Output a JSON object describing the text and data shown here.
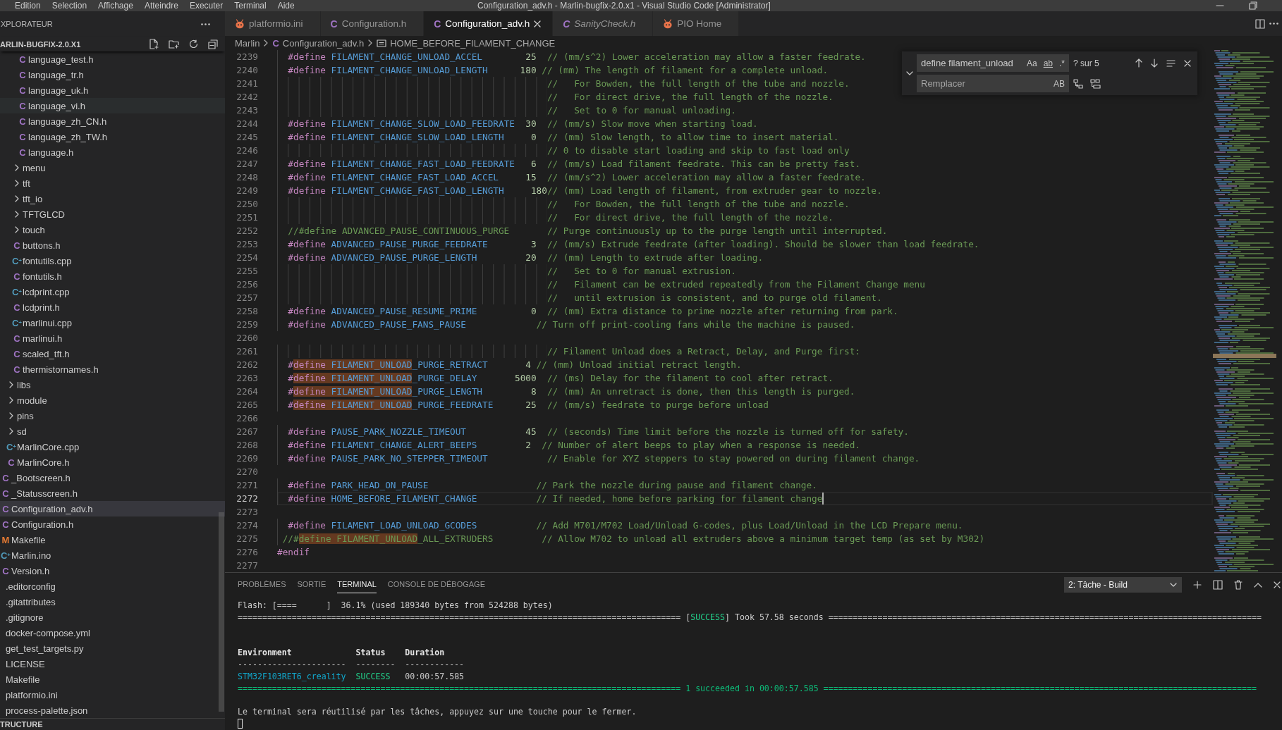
{
  "title_bar": {
    "menu": [
      "Edition",
      "Selection",
      "Affichage",
      "Atteindre",
      "Executer",
      "Terminal",
      "Aide"
    ],
    "title": "Configuration_adv.h - Marlin-bugfix-2.0.x1 - Visual Studio Code [Administrator]"
  },
  "sidebar": {
    "title": "XPLORATEUR",
    "project": "ARLIN-BUGFIX-2.0.X1",
    "tree": [
      {
        "children": [
          {
            "children": [
              {
                "children": [
                  {
                    "children": [
                      {
                        "label": "language_test.h",
                        "kind": "c",
                        "glyph": "C",
                        "selected": false,
                        "hovered": false
                      },
                      {
                        "label": "language_tr.h",
                        "kind": "c",
                        "glyph": "C",
                        "selected": false,
                        "hovered": false
                      },
                      {
                        "label": "language_uk.h",
                        "kind": "c",
                        "glyph": "C",
                        "selected": false,
                        "hovered": false
                      },
                      {
                        "label": "language_vi.h",
                        "kind": "c",
                        "glyph": "C",
                        "selected": false,
                        "hovered": true
                      },
                      {
                        "label": "language_zh_CN.h",
                        "kind": "c",
                        "glyph": "C",
                        "selected": false,
                        "hovered": false
                      },
                      {
                        "label": "language_zh_TW.h",
                        "kind": "c",
                        "glyph": "C",
                        "selected": false,
                        "hovered": false
                      },
                      {
                        "label": "language.h",
                        "kind": "c",
                        "glyph": "C",
                        "selected": false,
                        "hovered": false
                      }
                    ]
                  },
                  {
                    "label": "menu",
                    "kind": "folder",
                    "expanded": false,
                    "selected": false,
                    "hovered": false
                  },
                  {
                    "label": "tft",
                    "kind": "folder",
                    "expanded": false,
                    "selected": false,
                    "hovered": false
                  },
                  {
                    "label": "tft_io",
                    "kind": "folder",
                    "expanded": false,
                    "selected": false,
                    "hovered": false
                  },
                  {
                    "label": "TFTGLCD",
                    "kind": "folder",
                    "expanded": false,
                    "selected": false,
                    "hovered": false
                  },
                  {
                    "label": "touch",
                    "kind": "folder",
                    "expanded": false,
                    "selected": false,
                    "hovered": false
                  },
                  {
                    "label": "buttons.h",
                    "kind": "c",
                    "glyph": "C",
                    "selected": false,
                    "hovered": false
                  },
                  {
                    "label": "fontutils.cpp",
                    "kind": "cpp",
                    "glyph": "C$^{+}$",
                    "selected": false,
                    "hovered": false
                  },
                  {
                    "label": "fontutils.h",
                    "kind": "c",
                    "glyph": "C",
                    "selected": false,
                    "hovered": false
                  },
                  {
                    "label": "lcdprint.cpp",
                    "kind": "cpp",
                    "glyph": "C$^{+}$",
                    "selected": false,
                    "hovered": false
                  },
                  {
                    "label": "lcdprint.h",
                    "kind": "c",
                    "glyph": "C",
                    "selected": false,
                    "hovered": false
                  },
                  {
                    "label": "marlinui.cpp",
                    "kind": "cpp",
                    "glyph": "C$^{+}$",
                    "selected": false,
                    "hovered": false
                  },
                  {
                    "label": "marlinui.h",
                    "kind": "c",
                    "glyph": "C",
                    "selected": false,
                    "hovered": false
                  },
                  {
                    "label": "scaled_tft.h",
                    "kind": "c",
                    "glyph": "C",
                    "selected": false,
                    "hovered": false
                  },
                  {
                    "label": "thermistornames.h",
                    "kind": "c",
                    "glyph": "C",
                    "selected": false,
                    "hovered": false
                  }
                ]
              },
              {
                "label": "libs",
                "kind": "folder",
                "expanded": false,
                "selected": false,
                "hovered": false
              },
              {
                "label": "module",
                "kind": "folder",
                "expanded": false,
                "selected": false,
                "hovered": false
              },
              {
                "label": "pins",
                "kind": "folder",
                "expanded": false,
                "selected": false,
                "hovered": false
              },
              {
                "label": "sd",
                "kind": "folder",
                "expanded": false,
                "selected": false,
                "hovered": false
              },
              {
                "label": "MarlinCore.cpp",
                "kind": "cpp",
                "glyph": "C$^{+}$",
                "selected": false,
                "hovered": false
              },
              {
                "label": "MarlinCore.h",
                "kind": "c",
                "glyph": "C",
                "selected": false,
                "hovered": false
              }
            ]
          },
          {
            "label": "_Bootscreen.h",
            "kind": "c",
            "glyph": "C",
            "selected": false,
            "hovered": false
          },
          {
            "label": "_Statusscreen.h",
            "kind": "c",
            "glyph": "C",
            "selected": false,
            "hovered": false
          },
          {
            "label": "Configuration_adv.h",
            "kind": "c",
            "glyph": "C",
            "selected": true,
            "hovered": false
          },
          {
            "label": "Configuration.h",
            "kind": "c",
            "glyph": "C",
            "selected": false,
            "hovered": false
          },
          {
            "label": "Makefile",
            "kind": "make",
            "glyph": "M",
            "selected": false,
            "hovered": false
          },
          {
            "label": "Marlin.ino",
            "kind": "cpp",
            "glyph": "C$^{+}$",
            "selected": false,
            "hovered": false
          },
          {
            "label": "Version.h",
            "kind": "c",
            "glyph": "C",
            "selected": false,
            "hovered": false
          }
        ]
      },
      {
        "label": ".editorconfig",
        "selected": false,
        "hovered": false
      },
      {
        "label": ".gitattributes",
        "selected": false,
        "hovered": false
      },
      {
        "label": ".gitignore",
        "selected": false,
        "hovered": false
      },
      {
        "label": "docker-compose.yml",
        "selected": false,
        "hovered": false
      },
      {
        "label": "get_test_targets.py",
        "selected": false,
        "hovered": false
      },
      {
        "label": "LICENSE",
        "selected": false,
        "hovered": false
      },
      {
        "label": "Makefile",
        "selected": false,
        "hovered": false
      },
      {
        "label": "platformio.ini",
        "selected": false,
        "hovered": false
      },
      {
        "label": "process-palette.json",
        "selected": false,
        "hovered": false
      }
    ],
    "outline": "TRUCTURE"
  },
  "editor": {
    "tabs": [
      {
        "label": "platformio.ini",
        "kind": "pio",
        "selected": false,
        "preview": false
      },
      {
        "label": "Configuration.h",
        "kind": "c",
        "glyph": "C",
        "selected": false,
        "preview": false
      },
      {
        "label": "Configuration_adv.h",
        "kind": "c",
        "glyph": "C",
        "selected": true,
        "preview": false
      },
      {
        "label": "SanityCheck.h",
        "kind": "c",
        "glyph": "C",
        "selected": false,
        "preview": true
      },
      {
        "label": "PIO Home",
        "kind": "pio",
        "selected": false,
        "preview": false
      }
    ],
    "breadcrumbs": [
      {
        "kind": "folder",
        "label": "Marlin"
      },
      {
        "kind": "c",
        "glyph": "C",
        "label": "Configuration_adv.h"
      },
      {
        "kind": "symbol",
        "label": "HOME_BEFORE_FILAMENT_CHANGE"
      }
    ],
    "lines": [
      {
        "number": "2239",
        "current": false,
        "tokens": [
          {
            "kind": "directive",
            "text": "  #define",
            "match": false
          },
          {
            "kind": "macro",
            "text": " FILAMENT_CHANGE_UNLOAD_ACCEL",
            "match": false
          },
          {
            "kind": "number",
            "text": "        25",
            "match": false
          },
          {
            "kind": "comment",
            "text": "  // (mm/s^2) Lower acceleration may allow a faster feedrate.",
            "match": false
          }
        ]
      },
      {
        "number": "2240",
        "current": false,
        "tokens": [
          {
            "kind": "directive",
            "text": "  #define",
            "match": false
          },
          {
            "kind": "macro",
            "text": " FILAMENT_CHANGE_UNLOAD_LENGTH",
            "match": false
          },
          {
            "kind": "number",
            "text": "      180",
            "match": false
          },
          {
            "kind": "comment",
            "text": " // (mm) The length of filament for a complete unload.",
            "match": false
          }
        ]
      },
      {
        "number": "2241",
        "current": false,
        "tokens": [
          {
            "kind": "comment",
            "text": "                                                  //   For Bowden, the full length of the tube and nozzle.",
            "match": false
          }
        ]
      },
      {
        "number": "2242",
        "current": false,
        "tokens": [
          {
            "kind": "comment",
            "text": "                                                  //   For direct drive, the full length of the nozzle.",
            "match": false
          }
        ]
      },
      {
        "number": "2243",
        "current": false,
        "tokens": [
          {
            "kind": "comment",
            "text": "                                                  //   Set to 0 for manual unloading.",
            "match": false
          }
        ]
      },
      {
        "number": "2244",
        "current": false,
        "tokens": [
          {
            "kind": "directive",
            "text": "  #define",
            "match": false
          },
          {
            "kind": "macro",
            "text": " FILAMENT_CHANGE_SLOW_LOAD_FEEDRATE",
            "match": false
          },
          {
            "kind": "number",
            "text": "  30",
            "match": false
          },
          {
            "kind": "comment",
            "text": "  // (mm/s) Slow move when starting load.",
            "match": false
          }
        ]
      },
      {
        "number": "2245",
        "current": false,
        "tokens": [
          {
            "kind": "directive",
            "text": "  #define",
            "match": false
          },
          {
            "kind": "macro",
            "text": " FILAMENT_CHANGE_SLOW_LOAD_LENGTH",
            "match": false
          },
          {
            "kind": "number",
            "text": "     0",
            "match": false
          },
          {
            "kind": "comment",
            "text": "  // (mm) Slow length, to allow time to insert material.",
            "match": false
          }
        ]
      },
      {
        "number": "2246",
        "current": false,
        "tokens": [
          {
            "kind": "comment",
            "text": "                                                  // 0 to disable start loading and skip to fast load only",
            "match": false
          }
        ]
      },
      {
        "number": "2247",
        "current": false,
        "tokens": [
          {
            "kind": "directive",
            "text": "  #define",
            "match": false
          },
          {
            "kind": "macro",
            "text": " FILAMENT_CHANGE_FAST_LOAD_FEEDRATE",
            "match": false
          },
          {
            "kind": "number",
            "text": "   6",
            "match": false
          },
          {
            "kind": "comment",
            "text": "  // (mm/s) Load filament feedrate. This can be pretty fast.",
            "match": false
          }
        ]
      },
      {
        "number": "2248",
        "current": false,
        "tokens": [
          {
            "kind": "directive",
            "text": "  #define",
            "match": false
          },
          {
            "kind": "macro",
            "text": " FILAMENT_CHANGE_FAST_LOAD_ACCEL",
            "match": false
          },
          {
            "kind": "number",
            "text": "     15",
            "match": false
          },
          {
            "kind": "comment",
            "text": "  // (mm/s^2) Lower acceleration may allow a faster feedrate.",
            "match": false
          }
        ]
      },
      {
        "number": "2249",
        "current": false,
        "tokens": [
          {
            "kind": "directive",
            "text": "  #define",
            "match": false
          },
          {
            "kind": "macro",
            "text": " FILAMENT_CHANGE_FAST_LOAD_LENGTH",
            "match": false
          },
          {
            "kind": "number",
            "text": "     180",
            "match": false
          },
          {
            "kind": "comment",
            "text": "// (mm) Load length of filament, from extruder gear to nozzle.",
            "match": false
          }
        ]
      },
      {
        "number": "2250",
        "current": false,
        "tokens": [
          {
            "kind": "comment",
            "text": "                                                  //   For Bowden, the full length of the tube and nozzle.",
            "match": false
          }
        ]
      },
      {
        "number": "2251",
        "current": false,
        "tokens": [
          {
            "kind": "comment",
            "text": "                                                  //   For direct drive, the full length of the nozzle.",
            "match": false
          }
        ]
      },
      {
        "number": "2252",
        "current": false,
        "tokens": [
          {
            "kind": "comment",
            "text": "  //#define ADVANCED_PAUSE_CONTINUOUS_PURGE       // Purge continuously up to the purge length until interrupted.",
            "match": false
          }
        ]
      },
      {
        "number": "2253",
        "current": false,
        "tokens": [
          {
            "kind": "directive",
            "text": "  #define",
            "match": false
          },
          {
            "kind": "macro",
            "text": " ADVANCED_PAUSE_PURGE_FEEDRATE",
            "match": false
          },
          {
            "kind": "number",
            "text": "        3",
            "match": false
          },
          {
            "kind": "comment",
            "text": "  // (mm/s) Extrude feedrate (after loading). Should be slower than load feedrate.",
            "match": false
          }
        ]
      },
      {
        "number": "2254",
        "current": false,
        "tokens": [
          {
            "kind": "directive",
            "text": "  #define",
            "match": false
          },
          {
            "kind": "macro",
            "text": " ADVANCED_PAUSE_PURGE_LENGTH",
            "match": false
          },
          {
            "kind": "number",
            "text": "         20",
            "match": false
          },
          {
            "kind": "comment",
            "text": "  // (mm) Length to extrude after loading.",
            "match": false
          }
        ]
      },
      {
        "number": "2255",
        "current": false,
        "tokens": [
          {
            "kind": "comment",
            "text": "                                                  //   Set to 0 for manual extrusion.",
            "match": false
          }
        ]
      },
      {
        "number": "2256",
        "current": false,
        "tokens": [
          {
            "kind": "comment",
            "text": "                                                  //   Filament can be extruded repeatedly from the Filament Change menu",
            "match": false
          }
        ]
      },
      {
        "number": "2257",
        "current": false,
        "tokens": [
          {
            "kind": "comment",
            "text": "                                                  //   until extrusion is consistent, and to purge old filament.",
            "match": false
          }
        ]
      },
      {
        "number": "2258",
        "current": false,
        "tokens": [
          {
            "kind": "directive",
            "text": "  #define",
            "match": false
          },
          {
            "kind": "macro",
            "text": " ADVANCED_PAUSE_RESUME_PRIME",
            "match": false
          },
          {
            "kind": "number",
            "text": "          0",
            "match": false
          },
          {
            "kind": "comment",
            "text": "  // (mm) Extra distance to prime nozzle after returning from park.",
            "match": false
          }
        ]
      },
      {
        "number": "2259",
        "current": false,
        "tokens": [
          {
            "kind": "directive",
            "text": "  #define",
            "match": false
          },
          {
            "kind": "macro",
            "text": " ADVANCED_PAUSE_FANS_PAUSE",
            "match": false
          },
          {
            "kind": "comment",
            "text": "             // Turn off print-cooling fans while the machine is paused.",
            "match": false
          }
        ]
      },
      {
        "number": "2260",
        "current": false
      },
      {
        "number": "2261",
        "current": false,
        "tokens": [
          {
            "kind": "comment",
            "text": "                                                  // Filament Unload does a Retract, Delay, and Purge first:",
            "match": false
          }
        ]
      },
      {
        "number": "2262",
        "current": false,
        "tokens": [
          {
            "kind": "directive",
            "text": "  #",
            "match": false
          },
          {
            "kind": "directive",
            "text": "define",
            "match": true
          },
          {
            "kind": "macro",
            "text": " FILAMENT_UNLOAD",
            "match": true
          },
          {
            "kind": "macro",
            "text": "_PURGE_RETRACT",
            "match": false
          },
          {
            "kind": "number",
            "text": "       4",
            "match": false
          },
          {
            "kind": "comment",
            "text": " // (mm) Unload initial retract length.",
            "match": false
          }
        ]
      },
      {
        "number": "2263",
        "current": false,
        "tokens": [
          {
            "kind": "directive",
            "text": "  #",
            "match": false
          },
          {
            "kind": "directive",
            "text": "define",
            "match": true
          },
          {
            "kind": "macro",
            "text": " FILAMENT_UNLOAD",
            "match": true
          },
          {
            "kind": "macro",
            "text": "_PURGE_DELAY",
            "match": false
          },
          {
            "kind": "number",
            "text": "       5000",
            "match": false
          },
          {
            "kind": "comment",
            "text": "  // (ms) Delay for the filament to cool after retract.",
            "match": false
          }
        ]
      },
      {
        "number": "2264",
        "current": false,
        "tokens": [
          {
            "kind": "directive",
            "text": "  #",
            "match": false
          },
          {
            "kind": "directive",
            "text": "define",
            "match": true
          },
          {
            "kind": "macro",
            "text": " FILAMENT_UNLOAD",
            "match": true
          },
          {
            "kind": "macro",
            "text": "_PURGE_LENGTH",
            "match": false
          },
          {
            "kind": "number",
            "text": "         8",
            "match": false
          },
          {
            "kind": "comment",
            "text": "  // (mm) An unretract is done, then this length is purged.",
            "match": false
          }
        ]
      },
      {
        "number": "2265",
        "current": false,
        "tokens": [
          {
            "kind": "directive",
            "text": "  #",
            "match": false
          },
          {
            "kind": "directive",
            "text": "define",
            "match": true
          },
          {
            "kind": "macro",
            "text": " FILAMENT_UNLOAD",
            "match": true
          },
          {
            "kind": "macro",
            "text": "_PURGE_FEEDRATE",
            "match": false
          },
          {
            "kind": "number",
            "text": "      25",
            "match": false
          },
          {
            "kind": "comment",
            "text": "  // (mm/s) feedrate to purge before unload",
            "match": false
          }
        ]
      },
      {
        "number": "2266",
        "current": false
      },
      {
        "number": "2267",
        "current": false,
        "tokens": [
          {
            "kind": "directive",
            "text": "  #define",
            "match": false
          },
          {
            "kind": "macro",
            "text": " PAUSE_PARK_NOZZLE_TIMEOUT",
            "match": false
          },
          {
            "kind": "number",
            "text": "           45",
            "match": false
          },
          {
            "kind": "comment",
            "text": "  // (seconds) Time limit before the nozzle is turned off for safety.",
            "match": false
          }
        ]
      },
      {
        "number": "2268",
        "current": false,
        "tokens": [
          {
            "kind": "directive",
            "text": "  #define",
            "match": false
          },
          {
            "kind": "macro",
            "text": " FILAMENT_CHANGE_ALERT_BEEPS",
            "match": false
          },
          {
            "kind": "number",
            "text": "         2",
            "match": false
          },
          {
            "kind": "comment",
            "text": "  // Number of alert beeps to play when a response is needed.",
            "match": false
          }
        ]
      },
      {
        "number": "2269",
        "current": false,
        "tokens": [
          {
            "kind": "directive",
            "text": "  #define",
            "match": false
          },
          {
            "kind": "macro",
            "text": " PAUSE_PARK_NO_STEPPER_TIMEOUT",
            "match": false
          },
          {
            "kind": "comment",
            "text": "           // Enable for XYZ steppers to stay powered on during filament change.",
            "match": false
          }
        ]
      },
      {
        "number": "2270",
        "current": false
      },
      {
        "number": "2271",
        "current": false,
        "tokens": [
          {
            "kind": "directive",
            "text": "  #define",
            "match": false
          },
          {
            "kind": "macro",
            "text": " PARK_HEAD_ON_PAUSE",
            "match": false
          },
          {
            "kind": "comment",
            "text": "                    // Park the nozzle during pause and filament change.",
            "match": false
          }
        ]
      },
      {
        "number": "2272",
        "current": true,
        "tokens": [
          {
            "kind": "directive",
            "text": "  #define",
            "match": false
          },
          {
            "kind": "macro",
            "text": " HOME_BEFORE_FILAMENT_CHANGE",
            "match": false
          },
          {
            "kind": "comment",
            "text": "           // If needed, home before parking for filament change",
            "match": false
          }
        ]
      },
      {
        "number": "2273",
        "current": false
      },
      {
        "number": "2274",
        "current": false,
        "tokens": [
          {
            "kind": "directive",
            "text": "  #define",
            "match": false
          },
          {
            "kind": "macro",
            "text": " FILAMENT_LOAD_UNLOAD_GCODES",
            "match": false
          },
          {
            "kind": "comment",
            "text": "           // Add M701/M702 Load/Unload G-codes, plus Load/Unload in the LCD Prepare menu.",
            "match": false
          }
        ]
      },
      {
        "number": "2275",
        "current": false,
        "tokens": [
          {
            "kind": "comment",
            "text": " //#",
            "match": false
          },
          {
            "kind": "comment",
            "text": "define FILAMENT_UNLOAD",
            "match": true
          },
          {
            "kind": "comment",
            "text": "_ALL_EXTRUDERS",
            "match": false
          },
          {
            "kind": "comment",
            "text": "         // Allow M702 to unload all extruders above a minimum target temp (as set by M302)",
            "match": false
          }
        ]
      },
      {
        "number": "2276",
        "current": false,
        "tokens": [
          {
            "kind": "directive",
            "text": "#endif",
            "match": false
          }
        ]
      },
      {
        "number": "2277",
        "current": false
      }
    ],
    "find": {
      "expanded": true,
      "value": "define filament_unload",
      "toggles": [
        {
          "kind": "case",
          "label": "Aa",
          "on": false
        },
        {
          "kind": "word",
          "label": "ab",
          "on": false
        },
        {
          "kind": "regex",
          "label": ".*",
          "on": false
        }
      ],
      "count": "? sur 5",
      "replace": {
        "placeholder": "Remplacer",
        "toggles": [
          {
            "label": "AB",
            "on": false
          }
        ]
      }
    }
  },
  "panel": {
    "tabs": [
      {
        "label": "PROBLÈMES",
        "selected": false
      },
      {
        "label": "SORTIE",
        "selected": false
      },
      {
        "label": "TERMINAL",
        "selected": true
      },
      {
        "label": "CONSOLE DE DÉBOGAGE",
        "selected": false
      }
    ],
    "task": "2: Tâche - Build",
    "terminal": [
      {
        "kind": "text",
        "segments": [
          {
            "kind": "plain",
            "text": "Flash: [====      ]  36.1% (used 189340 bytes from 524288 bytes)"
          }
        ]
      },
      {
        "kind": "text",
        "segments": [
          {
            "kind": "plain",
            "text": "========================================================================================== ["
          },
          {
            "kind": "success",
            "text": "SUCCESS"
          },
          {
            "kind": "plain",
            "text": "] Took 57.58 seconds ========================================================================================"
          }
        ]
      },
      {
        "kind": "blank"
      },
      {
        "kind": "blank"
      },
      {
        "kind": "text",
        "segments": [
          {
            "kind": "bold",
            "text": "Environment             Status    Duration"
          }
        ]
      },
      {
        "kind": "text",
        "segments": [
          {
            "kind": "plain",
            "text": "----------------------  --------  ------------"
          }
        ]
      },
      {
        "kind": "text",
        "segments": [
          {
            "kind": "cyan",
            "text": "STM32F103RET6_creality"
          },
          {
            "kind": "success",
            "text": "  SUCCESS"
          },
          {
            "kind": "plain",
            "text": "   00:00:57.585"
          }
        ]
      },
      {
        "kind": "text",
        "segments": [
          {
            "kind": "green",
            "text": "========================================================================================== 1 succeeded in 00:00:57.585 ========================================================================================"
          }
        ]
      },
      {
        "kind": "blank"
      },
      {
        "kind": "text",
        "segments": [
          {
            "kind": "plain",
            "text": "Le terminal sera réutilisé par les tâches, appuyez sur une touche pour le fermer."
          }
        ]
      },
      {
        "kind": "cursor"
      }
    ]
  }
}
